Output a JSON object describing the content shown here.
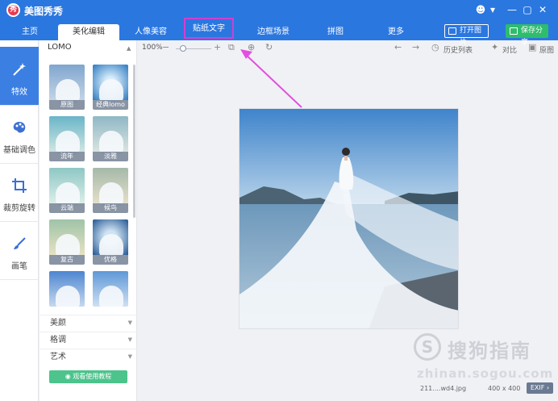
{
  "app": {
    "title": "美图秀秀",
    "logo_glyph": "秀"
  },
  "window_controls": [
    "☻",
    "▾",
    "—",
    "▢",
    "✕"
  ],
  "tabs": [
    {
      "label": "主页",
      "state": "normal"
    },
    {
      "label": "美化编辑",
      "state": "active"
    },
    {
      "label": "人像美容",
      "state": "normal"
    },
    {
      "label": "贴纸文字",
      "state": "highlighted"
    },
    {
      "label": "边框场景",
      "state": "normal"
    },
    {
      "label": "拼图",
      "state": "normal"
    },
    {
      "label": "更多",
      "state": "normal"
    }
  ],
  "header_buttons": {
    "open": "打开图片",
    "save": "保存分享"
  },
  "left_nav": [
    {
      "label": "特效",
      "icon": "magic-wand-icon",
      "active": true
    },
    {
      "label": "基础调色",
      "icon": "palette-icon",
      "active": false
    },
    {
      "label": "裁剪旋转",
      "icon": "crop-icon",
      "active": false
    },
    {
      "label": "画笔",
      "icon": "brush-icon",
      "active": false
    }
  ],
  "effects_panel": {
    "category": "LOMO",
    "thumbnails": [
      "原图",
      "经典lomo",
      "流年",
      "淡雅",
      "云端",
      "候鸟",
      "复古",
      "优格",
      "",
      ""
    ],
    "sections": [
      "美颜",
      "格调",
      "艺术"
    ],
    "tutorial_button": "观看使用教程"
  },
  "toolbar": {
    "zoom": "100%",
    "zoom_level": 0.2,
    "history_label": "历史列表",
    "compare_label": "对比",
    "original_label": "原图"
  },
  "status": {
    "filename": "211....wd4.jpg",
    "dimensions": "400 x 400",
    "exif": "EXIF"
  },
  "watermark": {
    "glyph": "S",
    "text": "搜狗指南",
    "url": "zhinan.sogou.com"
  },
  "colors": {
    "brand_blue": "#2b77e0",
    "save_green": "#2ebc6d",
    "highlight_magenta": "#d33fd0",
    "active_nav": "#3c7fe3"
  }
}
